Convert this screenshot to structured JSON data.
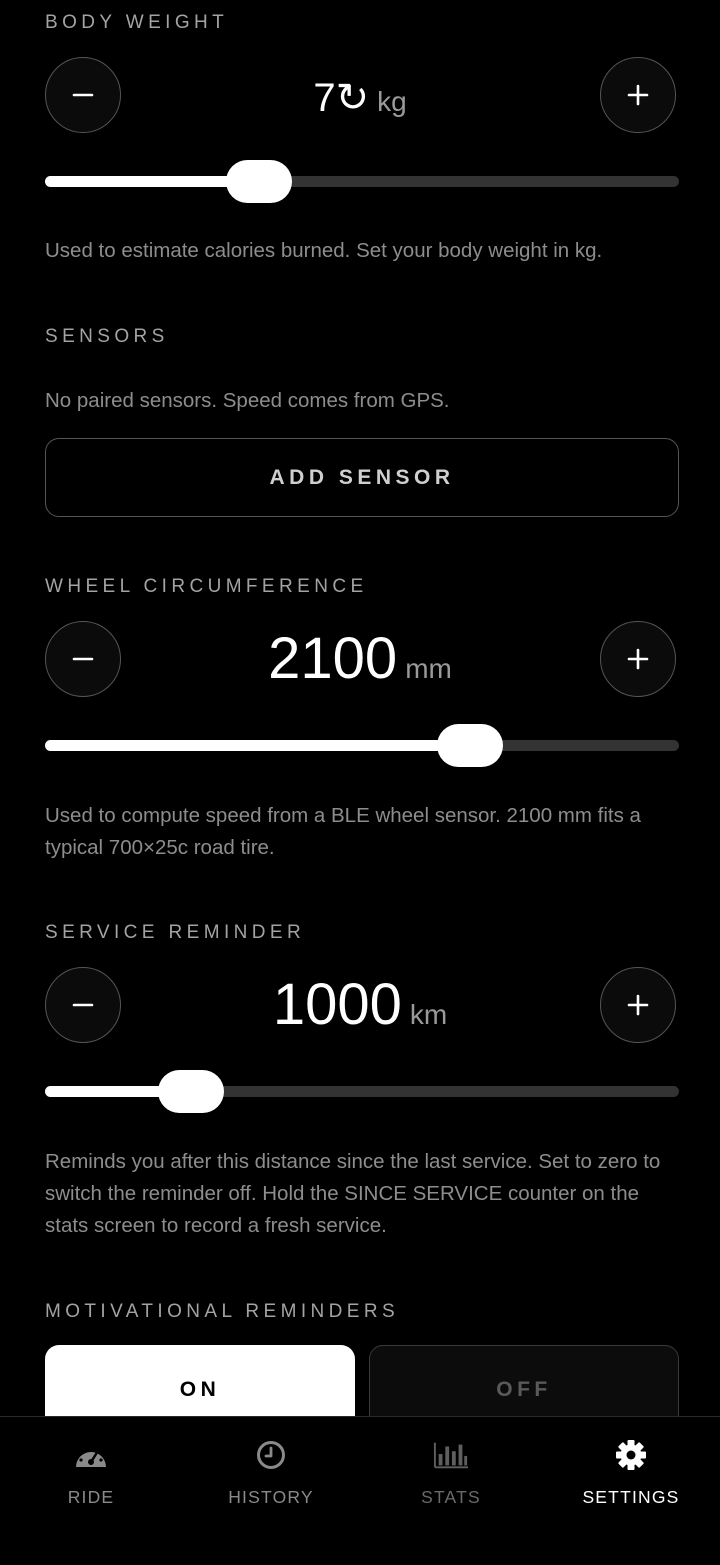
{
  "body_weight": {
    "label": "BODY WEIGHT",
    "value_text": "7↻",
    "unit": "kg",
    "slider_fraction": 0.337,
    "description": "Used to estimate calories burned. Set your body weight in kg."
  },
  "sensors": {
    "label": "SENSORS",
    "description": "No paired sensors. Speed comes from GPS.",
    "add_button": "ADD SENSOR"
  },
  "wheel_circumference": {
    "label": "WHEEL CIRCUMFERENCE",
    "value": "2100",
    "unit": "mm",
    "slider_fraction": 0.67,
    "description": "Used to compute speed from a BLE wheel sensor. 2100 mm fits a typical 700×25c road tire."
  },
  "service_reminder": {
    "label": "SERVICE REMINDER",
    "value": "1000",
    "unit": "km",
    "slider_fraction": 0.23,
    "description": "Reminds you after this distance since the last service. Set to zero to switch the reminder off. Hold the SINCE SERVICE counter on the stats screen to record a fresh service."
  },
  "motivational_reminders": {
    "label": "MOTIVATIONAL REMINDERS",
    "on_label": "ON",
    "off_label": "OFF",
    "selected": "ON"
  },
  "tabs": [
    {
      "label": "RIDE",
      "icon": "speedometer-icon",
      "active": false
    },
    {
      "label": "HISTORY",
      "icon": "clock-icon",
      "active": false
    },
    {
      "label": "STATS",
      "icon": "bar-chart-icon",
      "active": false
    },
    {
      "label": "SETTINGS",
      "icon": "gear-icon",
      "active": true
    }
  ],
  "colors": {
    "background": "#000000",
    "accent": "#ffffff",
    "muted_text": "#8d8d8d",
    "inactive_tab": "#8a8a8a"
  }
}
